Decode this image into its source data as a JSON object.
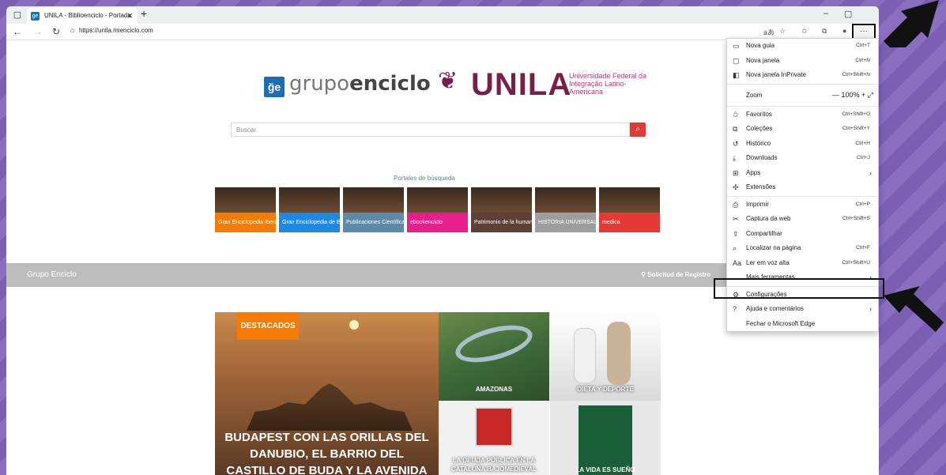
{
  "browser": {
    "tab_title": "UNILA - Biblioenciclo - Portada",
    "url": "https://unila.mienciclo.com"
  },
  "page": {
    "logo_grupo_a": "grupo",
    "logo_grupo_b": "enciclo",
    "logo_unila": "UNILA",
    "unila_sub": "Universidade Federal da Integração Latino-Americana",
    "search_placeholder": "Buscar",
    "portales_title": "Portales de búsqueda",
    "portals": [
      {
        "label": "Gran Enciclopedia Iberoamericana",
        "color": "#f57c00"
      },
      {
        "label": "Gran Enciclopedia de España",
        "color": "#1e88e5"
      },
      {
        "label": "Publicaciones Científicas",
        "color": "#5d8aa8"
      },
      {
        "label": "ebookenciclo",
        "color": "#e91e8c"
      },
      {
        "label": "Patrimonio de la humanidad",
        "color": "#5d4037"
      },
      {
        "label": "HISTORIA UNIVERSAL",
        "color": "#9e9e9e"
      },
      {
        "label": "medica",
        "color": "#e53935"
      }
    ],
    "band_title": "Grupo Enciclo",
    "band_registro": "Solicitud de Registro",
    "hero_badge": "DESTACADOS",
    "hero_text": "BUDAPEST CON LAS ORILLAS DEL DANUBIO, EL BARRIO DEL CASTILLO DE BUDA Y LA AVENIDA ANDRÁSSY",
    "tiles": [
      {
        "caption": "AMAZONAS"
      },
      {
        "caption": "DIETA Y DEPORTE"
      },
      {
        "caption": "LA DEUDA PÚBLICA EN LA CATALUÑA BAJOMEDIEVAL"
      },
      {
        "caption": "LA VIDA ES SUEÑO"
      }
    ]
  },
  "menu": {
    "items": [
      {
        "label": "Nova guia",
        "shortcut": "Ctrl+T",
        "icon": "tab-icon"
      },
      {
        "label": "Nova janela",
        "shortcut": "Ctrl+N",
        "icon": "window-icon"
      },
      {
        "label": "Nova janela InPrivate",
        "shortcut": "Ctrl+Shift+N",
        "icon": "inprivate-icon"
      },
      {
        "label": "Zoom",
        "value": "100%"
      },
      {
        "label": "Favoritos",
        "shortcut": "Ctrl+Shift+O",
        "icon": "favorites-icon"
      },
      {
        "label": "Coleções",
        "shortcut": "Ctrl+Shift+Y",
        "icon": "collections-icon"
      },
      {
        "label": "Histórico",
        "shortcut": "Ctrl+H",
        "icon": "history-icon"
      },
      {
        "label": "Downloads",
        "shortcut": "Ctrl+J",
        "icon": "download-icon"
      },
      {
        "label": "Apps",
        "icon": "apps-icon"
      },
      {
        "label": "Extensões",
        "icon": "extensions-icon"
      },
      {
        "label": "Imprimir",
        "shortcut": "Ctrl+P",
        "icon": "print-icon"
      },
      {
        "label": "Captura da web",
        "shortcut": "Ctrl+Shift+S",
        "icon": "capture-icon"
      },
      {
        "label": "Compartilhar",
        "icon": "share-icon"
      },
      {
        "label": "Localizar na página",
        "shortcut": "Ctrl+F",
        "icon": "find-icon"
      },
      {
        "label": "Ler em voz alta",
        "shortcut": "Ctrl+Shift+U",
        "icon": "read-aloud-icon"
      },
      {
        "label": "Mais ferramentas"
      },
      {
        "label": "Configurações",
        "icon": "gear-icon"
      },
      {
        "label": "Ajuda e comentários",
        "icon": "help-icon"
      },
      {
        "label": "Fechar o Microsoft Edge"
      }
    ]
  }
}
